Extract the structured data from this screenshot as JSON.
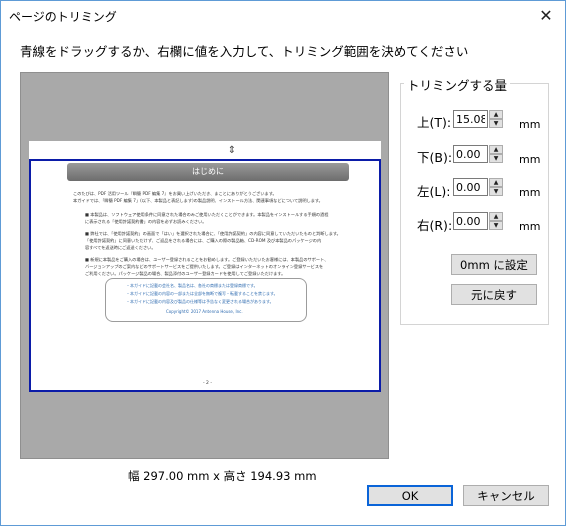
{
  "window": {
    "title": "ページのトリミング",
    "close_glyph": "✕"
  },
  "instruction": "青線をドラッグするか、右欄に値を入力して、トリミング範囲を決めてください",
  "preview": {
    "banner": "はじめに",
    "handle_glyph": "⇕",
    "page_number": "- 2 -",
    "lines": [
      "このたびは、PDF 活用ツール『瞬簡 PDF 編集 7』をお買い上げいただき、まことにありがとうございます。",
      "本ガイドでは、「瞬簡 PDF 編集 7」(以下、本製品と表記します)の製品説明、インストール方法、関連事項などについて説明します。",
      "■ 本製品は、ソフトウェア使用条件に同意された場合のみご使用いただくことができます。本製品をインストールする手順の過程",
      "  に表示される「使用許諾契約書」の内容を必ずお読みください。",
      "■ 弊社では、「使用許諾契約」の画面で「はい」を選択された場合に、「使用許諾契約」の内容に同意していただいたものと判断します。",
      "  「使用許諾契約」に同意いただけず、ご返品をされる場合には、ご購入の際の製品箱、CD-ROM 及び本製品のパッケージの内",
      "  容すべてを返送時にご返送ください。",
      "■ 新規に本製品をご購入の場合は、ユーザー登録されることをお勧めします。ご登録いただいたお客様には、本製品のサポート、",
      "  バージョンアップのご案内などのサポートサービスをご提供いたします。ご登録はインターネットのオンライン登録サービスを",
      "  ご利用ください。パッケージ製品の場合、製品添付のユーザー登録カードを使用してご登録いただけます。"
    ],
    "notes": [
      "・本ガイドに記載の会社名、製品名は、各社の商標または登録商標です。",
      "・本ガイドに記載の内容の一部または全部を無断で複写・転載することを禁じます。",
      "・本ガイドに記載の内容及び製品の仕様等は予告なく変更される場合があります。",
      "Copyright© 2017  Antenna House, Inc."
    ]
  },
  "dimensions": "幅 297.00 mm x 高さ 194.93 mm",
  "trim": {
    "group_label": "トリミングする量",
    "unit": "mm",
    "fields": [
      {
        "label": "上(T):",
        "value": "15.08"
      },
      {
        "label": "下(B):",
        "value": "0.00"
      },
      {
        "label": "左(L):",
        "value": "0.00"
      },
      {
        "label": "右(R):",
        "value": "0.00"
      }
    ],
    "spin_up": "▲",
    "spin_down": "▼",
    "zero_button": "0mm に設定",
    "reset_button": "元に戻す"
  },
  "buttons": {
    "ok": "OK",
    "cancel": "キャンセル"
  }
}
